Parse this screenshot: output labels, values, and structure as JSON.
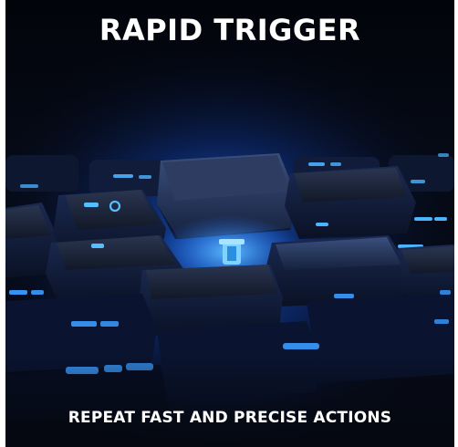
{
  "banner": {
    "headline": "RAPID TRIGGER",
    "tagline": "REPEAT FAST AND PRECISE ACTIONS"
  },
  "photo": {
    "subject": "keyboard-close-up",
    "accent_color": "#3fa9ff",
    "background_color": "#050810"
  }
}
